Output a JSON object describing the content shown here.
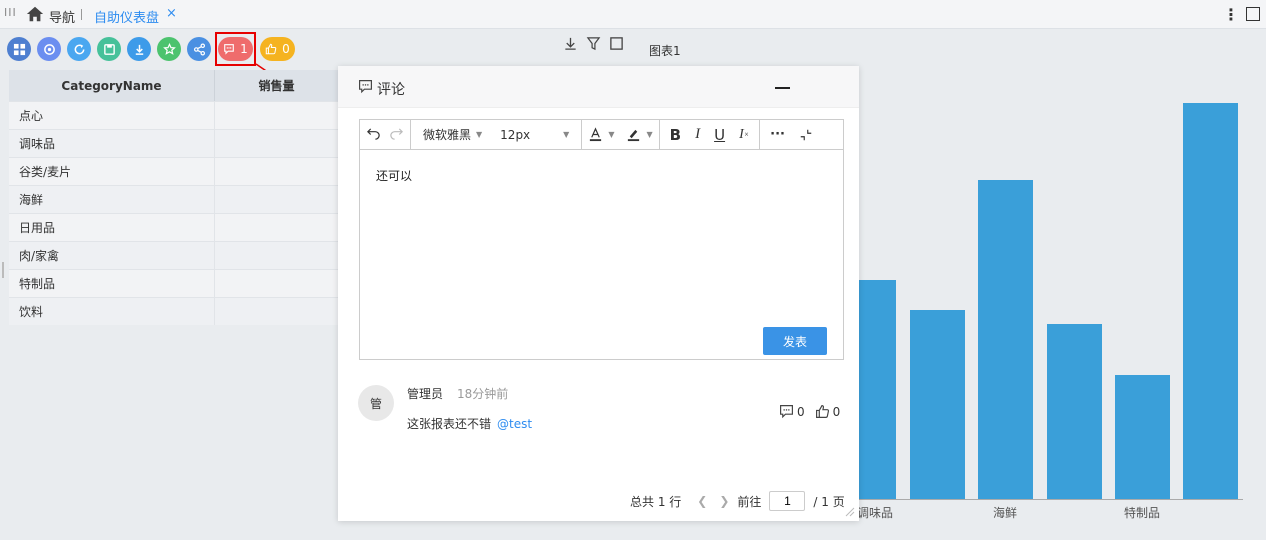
{
  "topbar": {
    "nav_label": "导航",
    "tab_label": "自助仪表盘",
    "tab_close": "×",
    "grip": "III",
    "kebab": "⋮"
  },
  "toolbar": {
    "buttons": [
      {
        "icon": "grid-icon",
        "color": "#4e7fd0"
      },
      {
        "icon": "refresh-circle-icon",
        "color": "#6b8ef0"
      },
      {
        "icon": "reload-icon",
        "color": "#4aa7f0"
      },
      {
        "icon": "save-icon",
        "color": "#46c19a"
      },
      {
        "icon": "download-icon",
        "color": "#3d9be9"
      },
      {
        "icon": "star-icon",
        "color": "#4cc36e"
      },
      {
        "icon": "share-icon",
        "color": "#4a90e2"
      }
    ],
    "comment_count": "1",
    "like_count": "0",
    "comment_color": "#ef6c6c",
    "like_color": "#f5b320"
  },
  "chart_header": {
    "title": "图表1"
  },
  "table": {
    "columns": [
      "CategoryName",
      "销售量"
    ],
    "rows": [
      "点心",
      "调味品",
      "谷类/麦片",
      "海鲜",
      "日用品",
      "肉/家禽",
      "特制品",
      "饮料"
    ]
  },
  "chart_data": {
    "type": "bar",
    "categories": [
      "调味品",
      "海鲜",
      "特制品"
    ],
    "series": [
      {
        "values": [
          219,
          189,
          319,
          175,
          124,
          396
        ]
      }
    ],
    "ylim": [
      0,
      430
    ],
    "color": "#3a9fd9"
  },
  "comment_panel": {
    "title": "评论",
    "editor": {
      "font_family": "微软雅黑",
      "font_size": "12px",
      "content": "还可以",
      "submit_label": "发表"
    },
    "comments": [
      {
        "avatar_text": "管",
        "author": "管理员",
        "time": "18分钟前",
        "text": "这张报表还不错",
        "mention": "@test",
        "reply_count": "0",
        "like_count": "0"
      }
    ],
    "pager": {
      "total_label": "总共 1 行",
      "goto_label": "前往",
      "current_page": "1",
      "pages_label": "/ 1 页"
    }
  }
}
